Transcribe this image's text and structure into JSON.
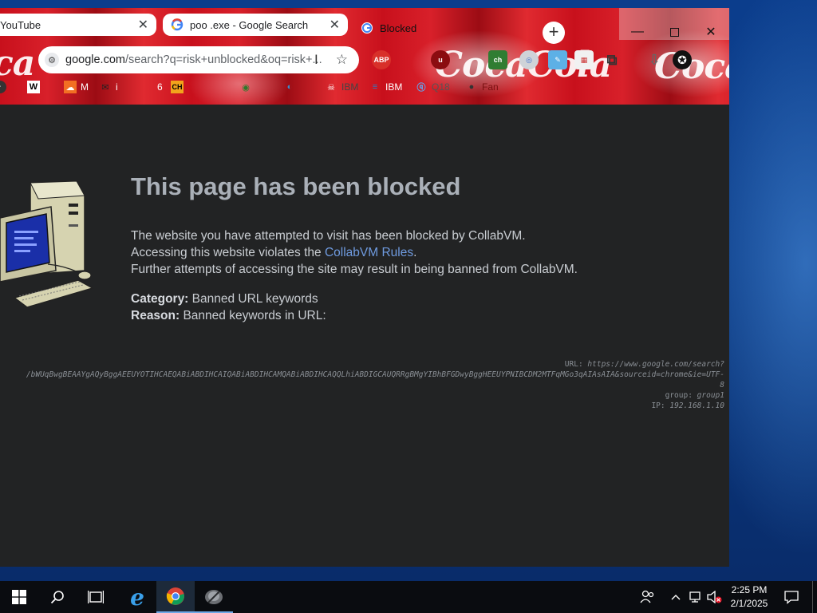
{
  "browser": {
    "tabs": [
      {
        "title": "YouTube",
        "state": "inactive"
      },
      {
        "title": "poo .exe - Google Search",
        "state": "inactive"
      },
      {
        "title": "Blocked",
        "state": "active"
      }
    ],
    "omnibox": {
      "url_host": "google.com",
      "url_path": "/search?q=risk+unblocked&oq=risk+..."
    },
    "extensions": [
      "ABP",
      "u",
      "ch",
      "R"
    ],
    "bookmarks": [
      {
        "icon": "W",
        "label": ""
      },
      {
        "icon": "sound",
        "label": "M"
      },
      {
        "icon": "envelope",
        "label": "i"
      },
      {
        "icon": "",
        "label": "6"
      },
      {
        "icon": "CH",
        "label": ""
      },
      {
        "icon": "globe",
        "label": ""
      },
      {
        "icon": "skull",
        "label": "IBM"
      },
      {
        "icon": "stripes",
        "label": "IBM"
      },
      {
        "icon": "q",
        "label": "Q18"
      },
      {
        "icon": "github",
        "label": "Fan"
      }
    ]
  },
  "blocked_page": {
    "title": "This page has been blocked",
    "line1": "The website you have attempted to visit has been blocked by CollabVM.",
    "line2_pre": "Accessing this website violates the ",
    "line2_link": "CollabVM Rules",
    "line2_post": ".",
    "line3": "Further attempts of accessing the site may result in being banned from CollabVM.",
    "category_label": "Category:",
    "category_value": "Banned URL keywords",
    "reason_label": "Reason:",
    "reason_value": "Banned keywords in URL:",
    "url_label": "URL:",
    "url_value": "https://www.google.com/search?",
    "url_value_cont": "/bWUqBwgBEAAYgAQyBggAEEUYOTIHCAEQABiABDIHCAIQABiABDIHCAMQABiABDIHCAQQLhiABDIGCAUQRRgBMgYIBhBFGDwyBggHEEUYPNIBCDM2MTFqMGo3qAIAsAIA&sourceid=chrome&ie=UTF-",
    "url_value_end": "8",
    "group_label": "group:",
    "group_value": "group1",
    "ip_label": "IP:",
    "ip_value": "192.168.1.10"
  },
  "taskbar": {
    "time": "2:25 PM",
    "date": "2/1/2025"
  }
}
